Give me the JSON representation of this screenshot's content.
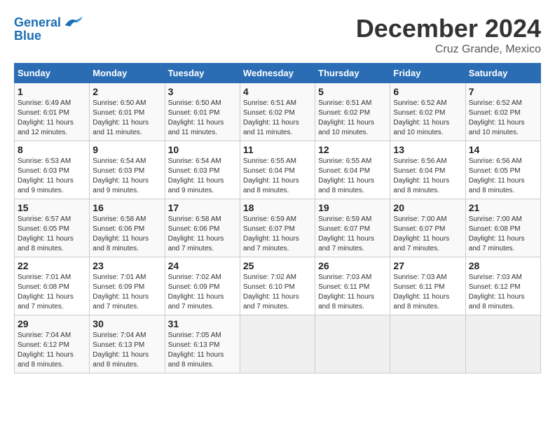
{
  "header": {
    "logo_line1": "General",
    "logo_line2": "Blue",
    "month": "December 2024",
    "location": "Cruz Grande, Mexico"
  },
  "weekdays": [
    "Sunday",
    "Monday",
    "Tuesday",
    "Wednesday",
    "Thursday",
    "Friday",
    "Saturday"
  ],
  "weeks": [
    [
      {
        "day": "1",
        "sunrise": "6:49 AM",
        "sunset": "6:01 PM",
        "daylight": "11 hours and 12 minutes."
      },
      {
        "day": "2",
        "sunrise": "6:50 AM",
        "sunset": "6:01 PM",
        "daylight": "11 hours and 11 minutes."
      },
      {
        "day": "3",
        "sunrise": "6:50 AM",
        "sunset": "6:01 PM",
        "daylight": "11 hours and 11 minutes."
      },
      {
        "day": "4",
        "sunrise": "6:51 AM",
        "sunset": "6:02 PM",
        "daylight": "11 hours and 11 minutes."
      },
      {
        "day": "5",
        "sunrise": "6:51 AM",
        "sunset": "6:02 PM",
        "daylight": "11 hours and 10 minutes."
      },
      {
        "day": "6",
        "sunrise": "6:52 AM",
        "sunset": "6:02 PM",
        "daylight": "11 hours and 10 minutes."
      },
      {
        "day": "7",
        "sunrise": "6:52 AM",
        "sunset": "6:02 PM",
        "daylight": "11 hours and 10 minutes."
      }
    ],
    [
      {
        "day": "8",
        "sunrise": "6:53 AM",
        "sunset": "6:03 PM",
        "daylight": "11 hours and 9 minutes."
      },
      {
        "day": "9",
        "sunrise": "6:54 AM",
        "sunset": "6:03 PM",
        "daylight": "11 hours and 9 minutes."
      },
      {
        "day": "10",
        "sunrise": "6:54 AM",
        "sunset": "6:03 PM",
        "daylight": "11 hours and 9 minutes."
      },
      {
        "day": "11",
        "sunrise": "6:55 AM",
        "sunset": "6:04 PM",
        "daylight": "11 hours and 8 minutes."
      },
      {
        "day": "12",
        "sunrise": "6:55 AM",
        "sunset": "6:04 PM",
        "daylight": "11 hours and 8 minutes."
      },
      {
        "day": "13",
        "sunrise": "6:56 AM",
        "sunset": "6:04 PM",
        "daylight": "11 hours and 8 minutes."
      },
      {
        "day": "14",
        "sunrise": "6:56 AM",
        "sunset": "6:05 PM",
        "daylight": "11 hours and 8 minutes."
      }
    ],
    [
      {
        "day": "15",
        "sunrise": "6:57 AM",
        "sunset": "6:05 PM",
        "daylight": "11 hours and 8 minutes."
      },
      {
        "day": "16",
        "sunrise": "6:58 AM",
        "sunset": "6:06 PM",
        "daylight": "11 hours and 8 minutes."
      },
      {
        "day": "17",
        "sunrise": "6:58 AM",
        "sunset": "6:06 PM",
        "daylight": "11 hours and 7 minutes."
      },
      {
        "day": "18",
        "sunrise": "6:59 AM",
        "sunset": "6:07 PM",
        "daylight": "11 hours and 7 minutes."
      },
      {
        "day": "19",
        "sunrise": "6:59 AM",
        "sunset": "6:07 PM",
        "daylight": "11 hours and 7 minutes."
      },
      {
        "day": "20",
        "sunrise": "7:00 AM",
        "sunset": "6:07 PM",
        "daylight": "11 hours and 7 minutes."
      },
      {
        "day": "21",
        "sunrise": "7:00 AM",
        "sunset": "6:08 PM",
        "daylight": "11 hours and 7 minutes."
      }
    ],
    [
      {
        "day": "22",
        "sunrise": "7:01 AM",
        "sunset": "6:08 PM",
        "daylight": "11 hours and 7 minutes."
      },
      {
        "day": "23",
        "sunrise": "7:01 AM",
        "sunset": "6:09 PM",
        "daylight": "11 hours and 7 minutes."
      },
      {
        "day": "24",
        "sunrise": "7:02 AM",
        "sunset": "6:09 PM",
        "daylight": "11 hours and 7 minutes."
      },
      {
        "day": "25",
        "sunrise": "7:02 AM",
        "sunset": "6:10 PM",
        "daylight": "11 hours and 7 minutes."
      },
      {
        "day": "26",
        "sunrise": "7:03 AM",
        "sunset": "6:11 PM",
        "daylight": "11 hours and 8 minutes."
      },
      {
        "day": "27",
        "sunrise": "7:03 AM",
        "sunset": "6:11 PM",
        "daylight": "11 hours and 8 minutes."
      },
      {
        "day": "28",
        "sunrise": "7:03 AM",
        "sunset": "6:12 PM",
        "daylight": "11 hours and 8 minutes."
      }
    ],
    [
      {
        "day": "29",
        "sunrise": "7:04 AM",
        "sunset": "6:12 PM",
        "daylight": "11 hours and 8 minutes."
      },
      {
        "day": "30",
        "sunrise": "7:04 AM",
        "sunset": "6:13 PM",
        "daylight": "11 hours and 8 minutes."
      },
      {
        "day": "31",
        "sunrise": "7:05 AM",
        "sunset": "6:13 PM",
        "daylight": "11 hours and 8 minutes."
      },
      null,
      null,
      null,
      null
    ]
  ]
}
